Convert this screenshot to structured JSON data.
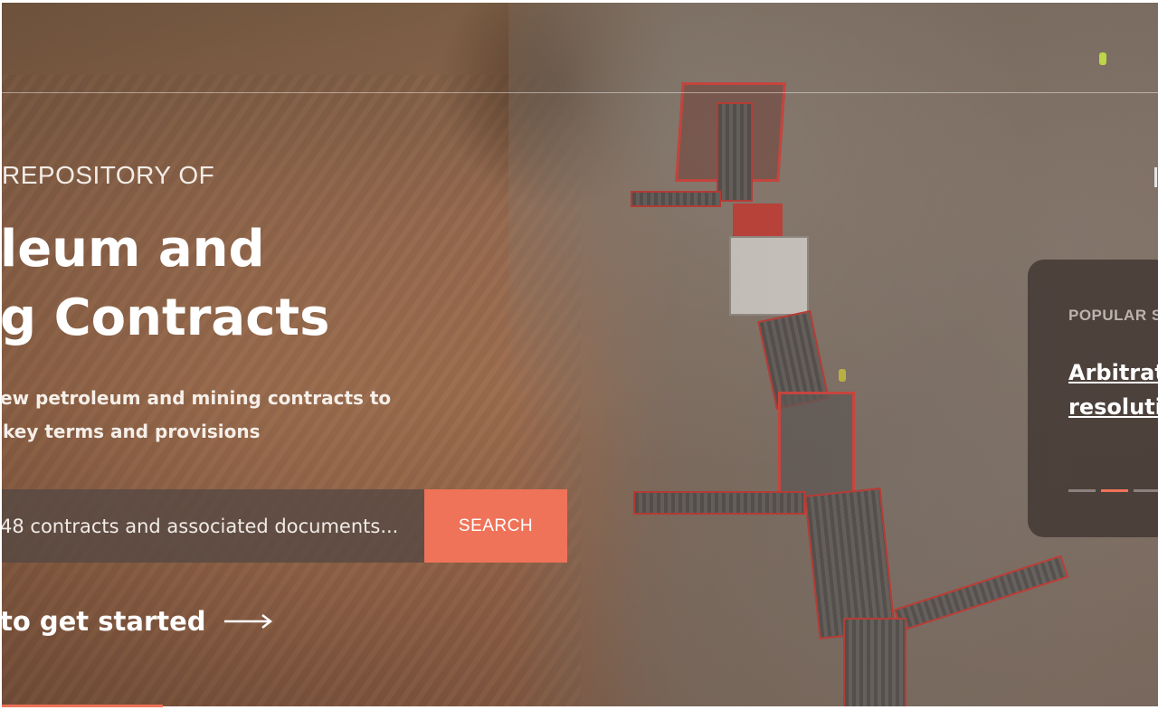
{
  "hero": {
    "eyebrow": "REPOSITORY OF",
    "title_line1": "leum and",
    "title_line2": "g Contracts",
    "subtitle_line1": "ew petroleum and mining contracts to",
    "subtitle_line2": "key terms and provisions"
  },
  "search": {
    "placeholder": "48 contracts and associated documents...",
    "button_label": "SEARCH"
  },
  "get_started": {
    "label": "to get started",
    "icon": "arrow-right-icon"
  },
  "popular": {
    "label": "POPULAR S",
    "link_line1": "Arbitrat",
    "link_line2": "resoluti",
    "dots_count": 3,
    "active_dot": 1
  },
  "colors": {
    "accent": "#ef7359",
    "search_bg": "#55484280",
    "card_bg": "#463a36"
  }
}
